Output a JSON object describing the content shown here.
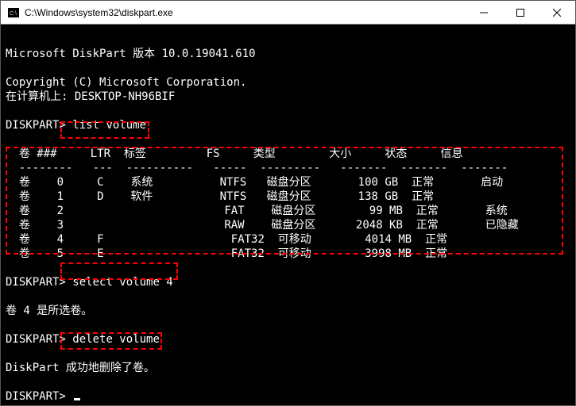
{
  "window": {
    "title": "C:\\Windows\\system32\\diskpart.exe"
  },
  "term": {
    "banner": "Microsoft DiskPart 版本 10.0.19041.610",
    "copyright": "Copyright (C) Microsoft Corporation.",
    "computer_line": "在计算机上: DESKTOP-NH96BIF",
    "prompt": "DISKPART>",
    "cmd_list": "list volume",
    "cmd_select": "select volume 4",
    "cmd_delete": "delete volume",
    "selected_msg": "卷 4 是所选卷。",
    "deleted_msg": "DiskPart 成功地删除了卷。",
    "table": {
      "headers": {
        "vol": "卷 ###",
        "ltr": "LTR",
        "label": "标签",
        "fs": "FS",
        "type": "类型",
        "size": "大小",
        "status": "状态",
        "info": "信息"
      },
      "rows": [
        {
          "vol": "卷    0",
          "ltr": "C",
          "label": "系统",
          "fs": "NTFS",
          "type": "磁盘分区",
          "size": "100 GB",
          "status": "正常",
          "info": "启动"
        },
        {
          "vol": "卷    1",
          "ltr": "D",
          "label": "软件",
          "fs": "NTFS",
          "type": "磁盘分区",
          "size": "138 GB",
          "status": "正常",
          "info": ""
        },
        {
          "vol": "卷    2",
          "ltr": "",
          "label": "",
          "fs": "FAT",
          "type": "磁盘分区",
          "size": "99 MB",
          "status": "正常",
          "info": "系统"
        },
        {
          "vol": "卷    3",
          "ltr": "",
          "label": "",
          "fs": "RAW",
          "type": "磁盘分区",
          "size": "2048 KB",
          "status": "正常",
          "info": "已隐藏"
        },
        {
          "vol": "卷    4",
          "ltr": "F",
          "label": "",
          "fs": "FAT32",
          "type": "可移动",
          "size": "4014 MB",
          "status": "正常",
          "info": ""
        },
        {
          "vol": "卷    5",
          "ltr": "E",
          "label": "",
          "fs": "FAT32",
          "type": "可移动",
          "size": "3998 MB",
          "status": "正常",
          "info": ""
        }
      ]
    }
  }
}
